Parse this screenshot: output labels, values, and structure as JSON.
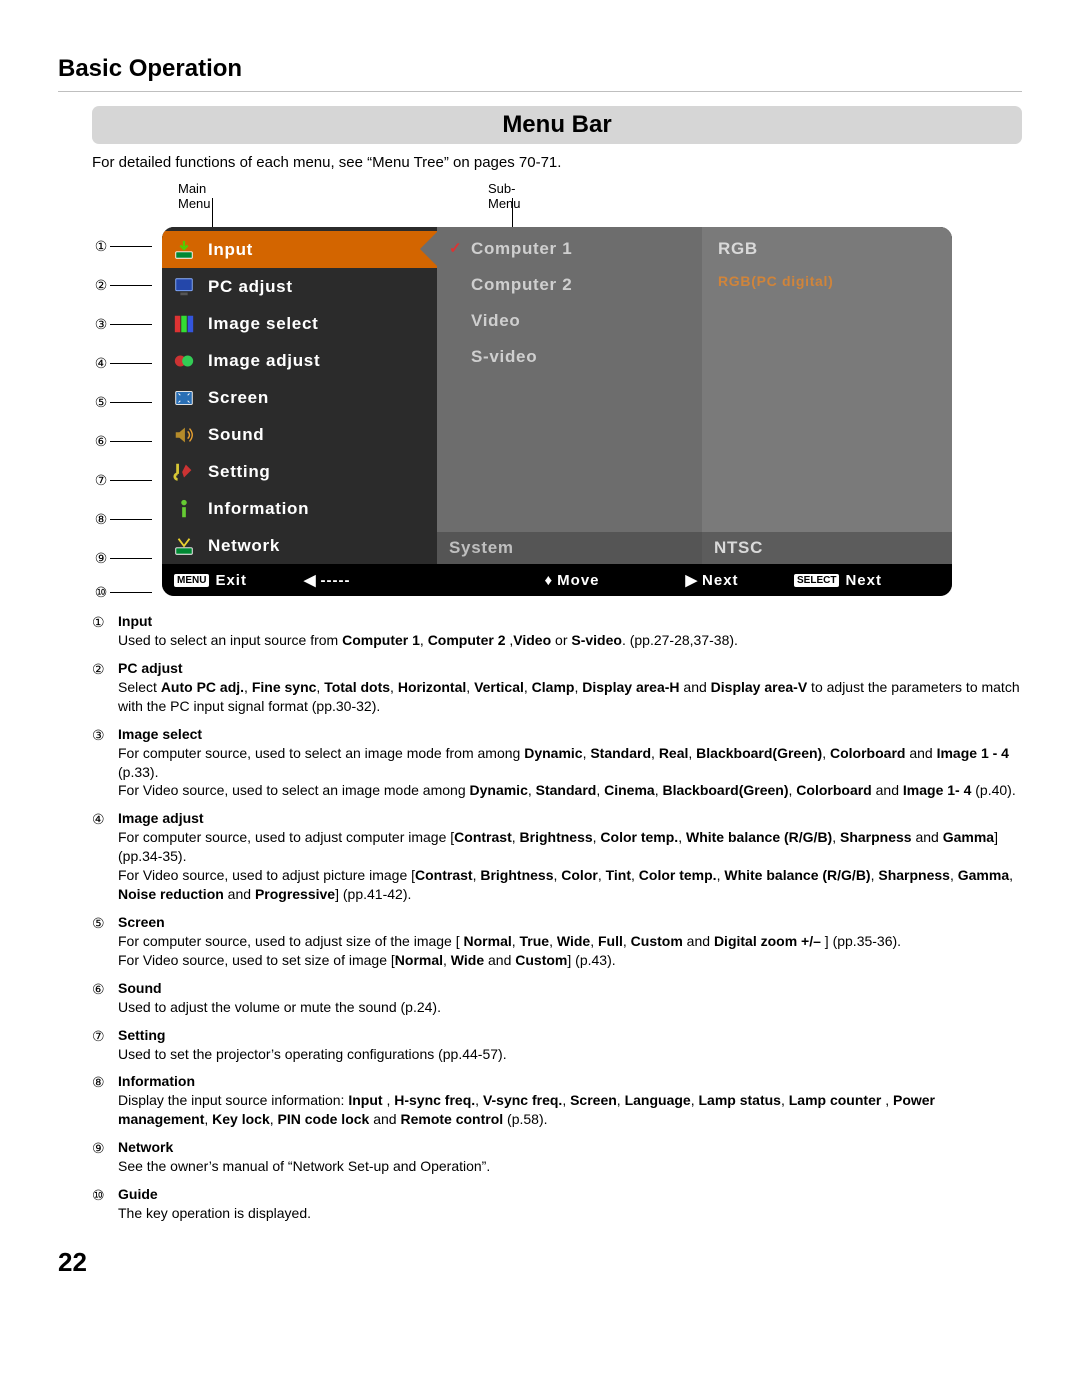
{
  "sectionTitle": "Basic Operation",
  "bannerTitle": "Menu Bar",
  "intro": "For detailed functions of each menu, see “Menu Tree” on pages 70-71.",
  "labels": {
    "main": "Main Menu",
    "sub": "Sub-Menu"
  },
  "circled": [
    "①",
    "②",
    "③",
    "④",
    "⑤",
    "⑥",
    "⑦",
    "⑧",
    "⑨",
    "⑩"
  ],
  "mainMenu": [
    "Input",
    "PC adjust",
    "Image select",
    "Image adjust",
    "Screen",
    "Sound",
    "Setting",
    "Information",
    "Network"
  ],
  "subMenu": [
    "Computer 1",
    "Computer 2",
    "Video",
    "S-video"
  ],
  "subFooter": "System",
  "detailMenu": [
    "RGB",
    "RGB(PC digital)"
  ],
  "detailFooter": "NTSC",
  "nav": {
    "menuBadge": "MENU",
    "exit": "Exit",
    "blank": "-----",
    "move": "Move",
    "next1": "Next",
    "selectBadge": "SELECT",
    "next2": "Next"
  },
  "desc": [
    {
      "n": "①",
      "title": "Input",
      "html": "Used to select an input source from <b>Computer 1</b>, <b>Computer 2</b> ,<b>Video</b> or <b>S-video</b>. (pp.27-28,37-38)."
    },
    {
      "n": "②",
      "title": "PC adjust",
      "html": "Select <b>Auto PC adj.</b>, <b>Fine sync</b>, <b>Total dots</b>, <b>Horizontal</b>, <b>Vertical</b>, <b>Clamp</b>, <b>Display area-H</b> and <b>Display area-V</b> to adjust the parameters to match with the PC input signal format (pp.30-32)."
    },
    {
      "n": "③",
      "title": "Image select",
      "html": "For computer source, used to select an image mode from among <b>Dynamic</b>, <b>Standard</b>, <b>Real</b>, <b>Blackboard(Green)</b>, <b>Colorboard</b> and <b>Image 1 - 4</b> (p.33).<br>For Video source, used to select an image mode among <b>Dynamic</b>, <b>Standard</b>, <b>Cinema</b>, <b>Blackboard(Green)</b>, <b>Colorboard</b> and <b>Image 1- 4</b> (p.40)."
    },
    {
      "n": "④",
      "title": "Image adjust",
      "html": "For computer source, used to adjust computer image [<b>Contrast</b>, <b>Brightness</b>, <b>Color temp.</b>, <b>White balance (R/G/B)</b>, <b>Sharpness</b> and <b>Gamma</b>] (pp.34-35).<br>For Video source, used to adjust picture image [<b>Contrast</b>, <b>Brightness</b>, <b>Color</b>, <b>Tint</b>, <b>Color temp.</b>, <b>White balance (R/G/B)</b>, <b>Sharpness</b>, <b>Gamma</b>, <b>Noise reduction</b> and <b>Progressive</b>] (pp.41-42)."
    },
    {
      "n": "⑤",
      "title": "Screen",
      "html": "For computer source, used to adjust size of the image [ <b>Normal</b>, <b>True</b>, <b>Wide</b>, <b>Full</b>, <b>Custom</b> and <b>Digital zoom +/–</b> ] (pp.35-36).<br>For Video source, used to set size of image [<b>Normal</b>, <b>Wide</b> and <b>Custom</b>] (p.43)."
    },
    {
      "n": "⑥",
      "title": "Sound",
      "html": "Used to adjust the volume or mute the sound (p.24)."
    },
    {
      "n": "⑦",
      "title": "Setting",
      "html": "Used to set the projector’s operating configurations (pp.44-57)."
    },
    {
      "n": "⑧",
      "title": "Information",
      "html": "Display the input source information: <b>Input</b> , <b>H-sync freq.</b>, <b>V-sync freq.</b>, <b>Screen</b>, <b>Language</b>, <b>Lamp status</b>, <b>Lamp counter</b> , <b>Power management</b>, <b>Key lock</b>, <b>PIN code lock</b> and <b>Remote control</b> (p.58)."
    },
    {
      "n": "⑨",
      "title": "Network",
      "html": "See the owner’s manual of “Network Set-up and Operation”."
    },
    {
      "n": "⑩",
      "title": "Guide",
      "html": "The key operation is displayed."
    }
  ],
  "pageNumber": "22"
}
